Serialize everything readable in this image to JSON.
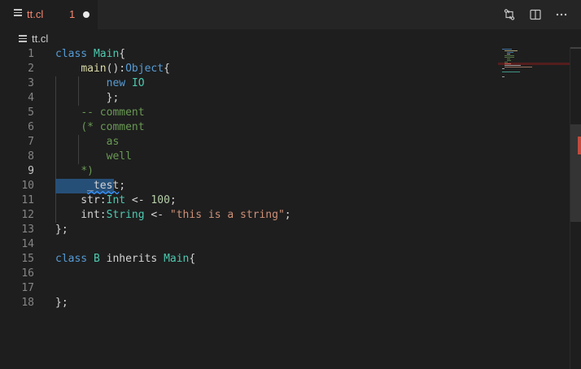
{
  "tab": {
    "name": "tt.cl",
    "problem_count": "1"
  },
  "breadcrumb": {
    "file": "tt.cl"
  },
  "editor": {
    "lines": [
      {
        "n": "1",
        "segs": [
          [
            "kw",
            "class "
          ],
          [
            "ty",
            "Main"
          ],
          [
            "",
            "{"
          ]
        ]
      },
      {
        "n": "2",
        "segs": [
          [
            "",
            "    "
          ],
          [
            "fn",
            "main"
          ],
          [
            "",
            "():"
          ],
          [
            "kw",
            "Object"
          ],
          [
            "",
            "{"
          ]
        ]
      },
      {
        "n": "3",
        "segs": [
          [
            "",
            "        "
          ],
          [
            "kw",
            "new "
          ],
          [
            "ty",
            "IO"
          ]
        ]
      },
      {
        "n": "4",
        "segs": [
          [
            "",
            "        };"
          ]
        ]
      },
      {
        "n": "5",
        "segs": [
          [
            "",
            "    "
          ],
          [
            "cm",
            "-- comment"
          ]
        ]
      },
      {
        "n": "6",
        "segs": [
          [
            "",
            "    "
          ],
          [
            "cm",
            "(* comment"
          ]
        ]
      },
      {
        "n": "7",
        "segs": [
          [
            "",
            "        "
          ],
          [
            "cm",
            "as"
          ]
        ]
      },
      {
        "n": "8",
        "segs": [
          [
            "",
            "        "
          ],
          [
            "cm",
            "well"
          ]
        ]
      },
      {
        "n": "9",
        "segs": [
          [
            "",
            "    "
          ],
          [
            "cm",
            "*)"
          ]
        ]
      },
      {
        "n": "10",
        "segs": [
          [
            "",
            "     "
          ],
          [
            "squig",
            "_test"
          ],
          [
            "",
            ";"
          ]
        ]
      },
      {
        "n": "11",
        "segs": [
          [
            "",
            "    str:"
          ],
          [
            "ty",
            "Int"
          ],
          [
            "",
            " <- "
          ],
          [
            "nm",
            "100"
          ],
          [
            "",
            ";"
          ]
        ]
      },
      {
        "n": "12",
        "segs": [
          [
            "",
            "    int:"
          ],
          [
            "ty",
            "String"
          ],
          [
            "",
            " <- "
          ],
          [
            "st",
            "\"this is a string\""
          ],
          [
            "",
            ";"
          ]
        ]
      },
      {
        "n": "13",
        "segs": [
          [
            "",
            "};"
          ]
        ]
      },
      {
        "n": "14",
        "segs": []
      },
      {
        "n": "15",
        "segs": [
          [
            "kw",
            "class "
          ],
          [
            "ty",
            "B "
          ],
          [
            "",
            "inherits "
          ],
          [
            "ty",
            "Main"
          ],
          [
            "",
            "{"
          ]
        ]
      },
      {
        "n": "16",
        "segs": []
      },
      {
        "n": "17",
        "segs": []
      },
      {
        "n": "18",
        "segs": [
          [
            "",
            "};"
          ]
        ]
      }
    ],
    "active_line": "9",
    "selected_line": "10"
  },
  "icons": {
    "file": "file-lines-icon",
    "compare": "open-changes-icon",
    "split": "split-editor-icon",
    "more": "more-actions-icon"
  },
  "colors": {
    "error": "#f48771",
    "keyword": "#569cd6",
    "type": "#4ec9b0",
    "comment": "#6a9955",
    "string": "#ce9178",
    "selection": "#264f78"
  }
}
